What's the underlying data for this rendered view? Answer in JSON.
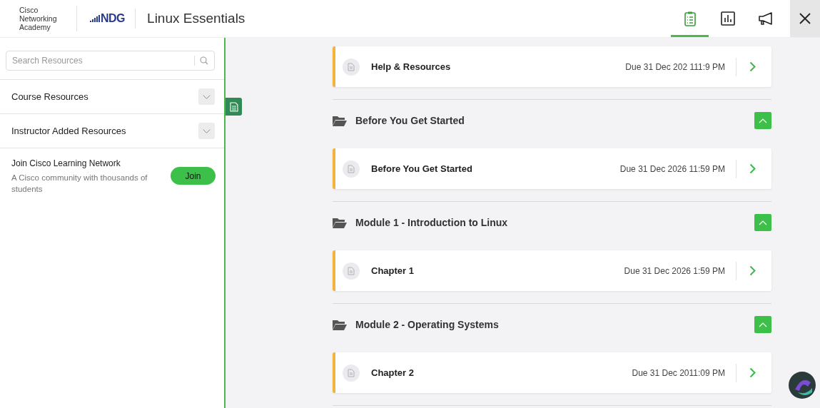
{
  "header": {
    "brand_lines": [
      "Cisco",
      "Networking",
      "Academy"
    ],
    "partner_logo": "NDG",
    "title": "Linux Essentials",
    "toolbar": [
      {
        "kind": "clipboard",
        "selected": true
      },
      {
        "kind": "chart",
        "selected": false
      },
      {
        "kind": "megaphone",
        "selected": false
      }
    ]
  },
  "sidebar": {
    "search": {
      "placeholder": "Search Resources"
    },
    "accordions": [
      {
        "label": "Course Resources",
        "expanded": false
      },
      {
        "label": "Instructor Added Resources",
        "expanded": false
      }
    ],
    "join": {
      "title": "Join Cisco Learning Network",
      "description": "A Cisco community with thousands of students",
      "button": "Join"
    }
  },
  "top_item": {
    "title": "Help & Resources",
    "due": "Due 31 Dec 202 111:9 PM"
  },
  "sections": [
    {
      "title": "Before You Get Started",
      "expanded": true,
      "items": [
        {
          "title": "Before You Get Started",
          "due": "Due 31 Dec 2026 11:59 PM"
        }
      ]
    },
    {
      "title": "Module 1 - Introduction to Linux",
      "expanded": true,
      "items": [
        {
          "title": "Chapter 1",
          "due": "Due 31 Dec 2026 1:59 PM"
        }
      ]
    },
    {
      "title": "Module 2 - Operating Systems",
      "expanded": true,
      "items": [
        {
          "title": "Chapter 2",
          "due": "Due 31 Dec 2011:09 PM"
        }
      ]
    }
  ]
}
